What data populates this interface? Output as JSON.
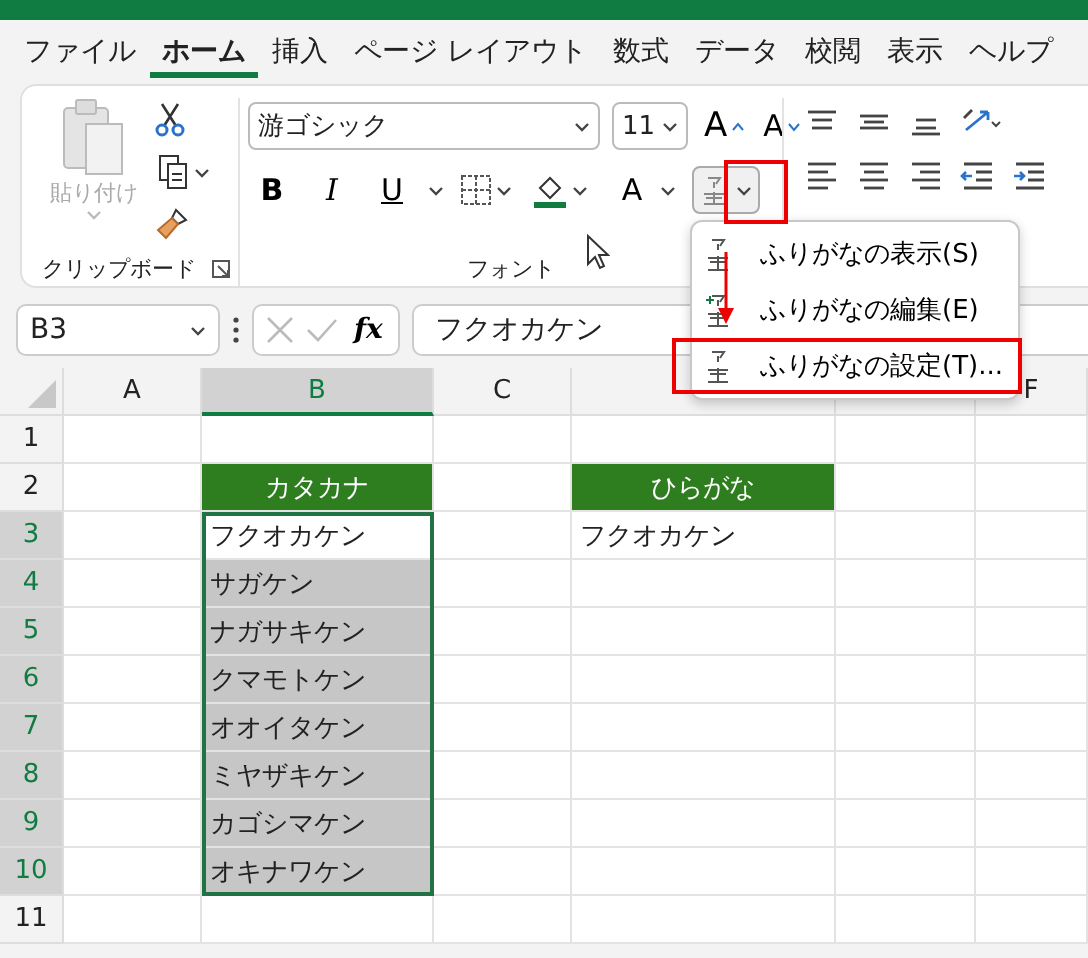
{
  "tabs": [
    {
      "label": "ファイル",
      "selected": false
    },
    {
      "label": "ホーム",
      "selected": true
    },
    {
      "label": "挿入",
      "selected": false
    },
    {
      "label": "ページ レイアウト",
      "selected": false
    },
    {
      "label": "数式",
      "selected": false
    },
    {
      "label": "データ",
      "selected": false
    },
    {
      "label": "校閲",
      "selected": false
    },
    {
      "label": "表示",
      "selected": false
    },
    {
      "label": "ヘルプ",
      "selected": false
    }
  ],
  "ribbon": {
    "clipboard": {
      "paste_label": "貼り付け",
      "group_label": "クリップボード"
    },
    "font": {
      "font_name": "游ゴシック",
      "font_size": "11",
      "grow_label": "A",
      "shrink_label": "A",
      "style_buttons": [
        {
          "kind": "bold",
          "label": "B"
        },
        {
          "kind": "italic",
          "label": "I"
        },
        {
          "kind": "underline",
          "label": "U"
        }
      ],
      "font_color_label": "A",
      "group_label": "フォント"
    }
  },
  "phonetic_menu": {
    "open": true,
    "items": [
      {
        "label": "ふりがなの表示(S)",
        "highlighted": false
      },
      {
        "label": "ふりがなの編集(E)",
        "highlighted": false
      },
      {
        "label": "ふりがなの設定(T)...",
        "highlighted": true
      }
    ]
  },
  "formula_bar": {
    "name_box": "B3",
    "fx_label": "fx",
    "formula": "フクオカケン"
  },
  "grid": {
    "columns": [
      {
        "label": "A",
        "selected": false
      },
      {
        "label": "B",
        "selected": true
      },
      {
        "label": "C",
        "selected": false
      },
      {
        "selected": false
      },
      {
        "selected": false
      },
      {
        "label": "F",
        "selected": false
      }
    ],
    "rows": [
      {
        "label": "1",
        "selected": false,
        "cells": []
      },
      {
        "label": "2",
        "selected": false,
        "cells": [
          {
            "text": "",
            "kind": "plain"
          },
          {
            "text": "カタカナ",
            "kind": "header"
          },
          {
            "text": "",
            "kind": "plain"
          },
          {
            "text": "ひらがな",
            "kind": "header"
          }
        ]
      },
      {
        "label": "3",
        "selected": true,
        "cells": [
          {
            "text": "",
            "kind": "plain"
          },
          {
            "text": "フクオカケン",
            "kind": "active"
          },
          {
            "text": "",
            "kind": "plain"
          },
          {
            "text": "フクオカケン",
            "kind": "plain"
          }
        ]
      },
      {
        "label": "4",
        "selected": true,
        "cells": [
          {
            "text": "",
            "kind": "plain"
          },
          {
            "text": "サガケン",
            "kind": "selected"
          }
        ]
      },
      {
        "label": "5",
        "selected": true,
        "cells": [
          {
            "text": "",
            "kind": "plain"
          },
          {
            "text": "ナガサキケン",
            "kind": "selected"
          }
        ]
      },
      {
        "label": "6",
        "selected": true,
        "cells": [
          {
            "text": "",
            "kind": "plain"
          },
          {
            "text": "クマモトケン",
            "kind": "selected"
          }
        ]
      },
      {
        "label": "7",
        "selected": true,
        "cells": [
          {
            "text": "",
            "kind": "plain"
          },
          {
            "text": "オオイタケン",
            "kind": "selected"
          }
        ]
      },
      {
        "label": "8",
        "selected": true,
        "cells": [
          {
            "text": "",
            "kind": "plain"
          },
          {
            "text": "ミヤザキケン",
            "kind": "selected"
          }
        ]
      },
      {
        "label": "9",
        "selected": true,
        "cells": [
          {
            "text": "",
            "kind": "plain"
          },
          {
            "text": "カゴシマケン",
            "kind": "selected"
          }
        ]
      },
      {
        "label": "10",
        "selected": true,
        "cells": [
          {
            "text": "",
            "kind": "plain"
          },
          {
            "text": "オキナワケン",
            "kind": "selected"
          }
        ]
      },
      {
        "label": "11",
        "selected": false,
        "cells": []
      }
    ]
  }
}
